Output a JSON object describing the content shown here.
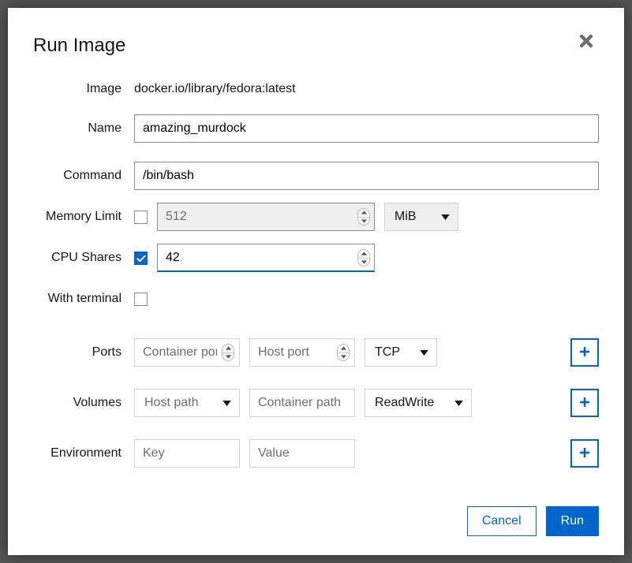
{
  "modal": {
    "title": "Run Image"
  },
  "labels": {
    "image": "Image",
    "name": "Name",
    "command": "Command",
    "memory": "Memory Limit",
    "cpu": "CPU Shares",
    "terminal": "With terminal",
    "ports": "Ports",
    "volumes": "Volumes",
    "env": "Environment"
  },
  "values": {
    "image": "docker.io/library/fedora:latest",
    "name": "amazing_murdock",
    "command": "/bin/bash",
    "memory": "512",
    "memory_unit": "MiB",
    "cpu": "42"
  },
  "ports": {
    "container_placeholder": "Container port",
    "host_placeholder": "Host port",
    "proto": "TCP"
  },
  "volumes": {
    "host_label": "Host path",
    "container_placeholder": "Container path",
    "mode": "ReadWrite"
  },
  "env": {
    "key_placeholder": "Key",
    "value_placeholder": "Value"
  },
  "footer": {
    "cancel": "Cancel",
    "run": "Run"
  }
}
